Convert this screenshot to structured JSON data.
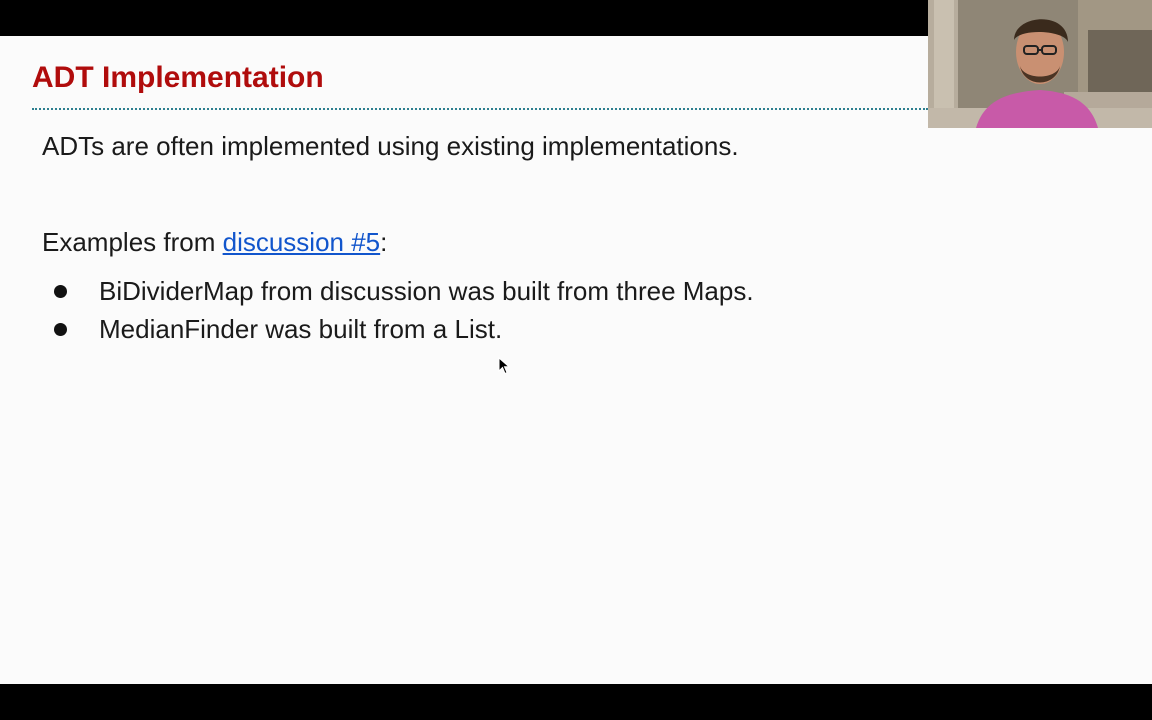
{
  "slide": {
    "title": "ADT Implementation",
    "intro": "ADTs are often implemented using existing implementations.",
    "examples_prefix": "Examples from ",
    "examples_link": "discussion #5",
    "examples_suffix": ":",
    "bullets": [
      "BiDividerMap from discussion was built from three Maps.",
      "MedianFinder was built from a List."
    ]
  },
  "colors": {
    "title": "#b00c0c",
    "link": "#1155cc",
    "rule": "#2d7f8f",
    "slide_background": "#fbfbfb",
    "frame": "#000000"
  },
  "icons": {
    "cursor": "mouse-pointer-icon"
  }
}
